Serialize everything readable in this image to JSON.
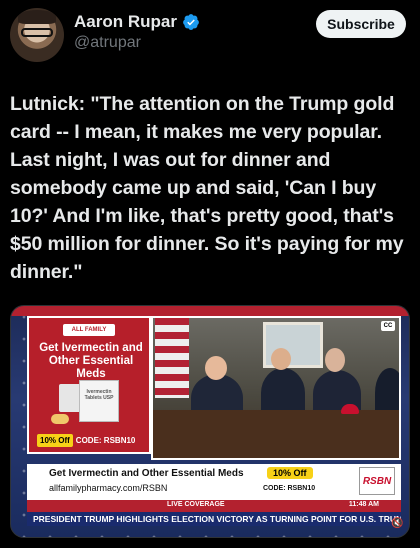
{
  "author": {
    "name": "Aaron Rupar",
    "handle": "@atrupar",
    "verified": true,
    "avatar_icon": "avatar"
  },
  "actions": {
    "subscribe_label": "Subscribe"
  },
  "tweet": {
    "text": "Lutnick: \"The attention on the Trump gold card -- I mean, it makes me very popular. Last night, I was out for dinner and somebody came up and said, 'Can I buy 10?' And I'm like, that's pretty good, that's $50 million for dinner. So it's paying for my dinner.\""
  },
  "video": {
    "ad_brand": "ALL FAMILY PHARMACY",
    "ad_title": "Get Ivermectin and Other Essential Meds",
    "ad_product": "Ivermectin Tablets USP",
    "ad_off": "10% Off",
    "ad_code": "CODE: RSBN10",
    "cc_label": "CC",
    "lower_line1": "Get Ivermectin and Other Essential Meds",
    "lower_line2": "allfamilypharmacy.com/RSBN",
    "lower_off": "10% Off",
    "lower_code": "CODE: RSBN10",
    "network": "RSBN",
    "live_label": "LIVE COVERAGE",
    "time": "11:48 AM",
    "ticker": "PRESIDENT TRUMP HIGHLIGHTS ELECTION VICTORY AS TURNING POINT FOR U.S.   TRUMP TH"
  },
  "colors": {
    "background": "#000000",
    "text": "#e7e9ea",
    "muted": "#71767b",
    "verified": "#1d9bf0",
    "ad_red": "#b61f2a",
    "ticker_blue": "#1a2b6e"
  }
}
